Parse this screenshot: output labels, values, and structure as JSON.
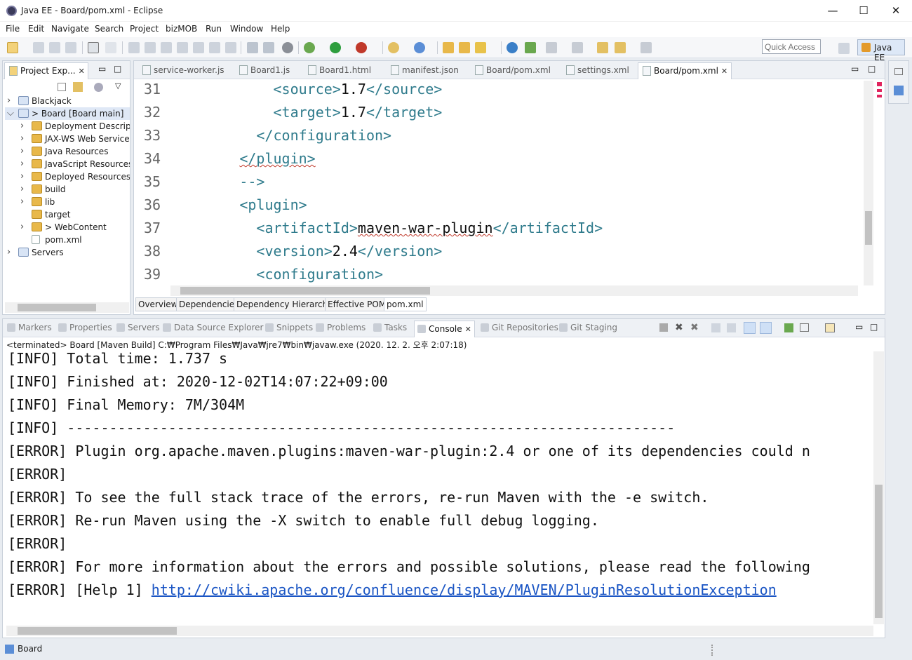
{
  "window": {
    "title": "Java EE - Board/pom.xml - Eclipse",
    "minimize": "—",
    "maximize": "☐",
    "close": "✕"
  },
  "menu": [
    "File",
    "Edit",
    "Navigate",
    "Search",
    "Project",
    "bizMOB",
    "Run",
    "Window",
    "Help"
  ],
  "toolbar": {
    "quick_access_placeholder": "Quick Access",
    "perspective_label": "Java EE"
  },
  "project_explorer": {
    "tab_label": "Project Exp...",
    "items": [
      {
        "label": "Blackjack",
        "level": 0,
        "expanded": false
      },
      {
        "label": "> Board  [Board main]",
        "level": 0,
        "expanded": true,
        "selected": true
      },
      {
        "label": "Deployment Descript",
        "level": 1,
        "expanded": false
      },
      {
        "label": "JAX-WS Web Services",
        "level": 1,
        "expanded": false
      },
      {
        "label": "Java Resources",
        "level": 1,
        "expanded": false
      },
      {
        "label": "JavaScript Resources",
        "level": 1,
        "expanded": false
      },
      {
        "label": "Deployed Resources",
        "level": 1,
        "expanded": false
      },
      {
        "label": "build",
        "level": 1,
        "expanded": false
      },
      {
        "label": "lib",
        "level": 1,
        "expanded": false
      },
      {
        "label": "target",
        "level": 1,
        "expanded": null
      },
      {
        "label": "> WebContent",
        "level": 1,
        "expanded": false
      },
      {
        "label": "pom.xml",
        "level": 1,
        "expanded": null
      },
      {
        "label": "Servers",
        "level": 0,
        "expanded": false
      }
    ]
  },
  "editor": {
    "tabs": [
      {
        "label": "service-worker.js",
        "active": false
      },
      {
        "label": "Board1.js",
        "active": false
      },
      {
        "label": "Board1.html",
        "active": false
      },
      {
        "label": "manifest.json",
        "active": false
      },
      {
        "label": "Board/pom.xml",
        "active": false
      },
      {
        "label": "settings.xml",
        "active": false
      },
      {
        "label": "Board/pom.xml",
        "active": true
      }
    ],
    "lines": [
      {
        "num": "31",
        "indent": "      ",
        "parts": [
          [
            "tag",
            "<source>"
          ],
          [
            "txt",
            "1.7"
          ],
          [
            "tag",
            "</source>"
          ]
        ]
      },
      {
        "num": "32",
        "indent": "      ",
        "parts": [
          [
            "tag",
            "<target>"
          ],
          [
            "txt",
            "1.7"
          ],
          [
            "tag",
            "</target>"
          ]
        ]
      },
      {
        "num": "33",
        "indent": "    ",
        "parts": [
          [
            "tag",
            "</configuration>"
          ]
        ]
      },
      {
        "num": "34",
        "indent": "  ",
        "parts": [
          [
            "tagw",
            "</plugin>"
          ]
        ]
      },
      {
        "num": "35",
        "indent": "  ",
        "parts": [
          [
            "tag",
            "-->"
          ]
        ]
      },
      {
        "num": "36",
        "indent": "  ",
        "parts": [
          [
            "tag",
            "<plugin>"
          ]
        ]
      },
      {
        "num": "37",
        "indent": "    ",
        "parts": [
          [
            "tag",
            "<artifactId>"
          ],
          [
            "txtw",
            "maven-war-plugin"
          ],
          [
            "tag",
            "</artifactId>"
          ]
        ]
      },
      {
        "num": "38",
        "indent": "    ",
        "parts": [
          [
            "tag",
            "<version>"
          ],
          [
            "txt",
            "2.4"
          ],
          [
            "tag",
            "</version>"
          ]
        ]
      },
      {
        "num": "39",
        "indent": "    ",
        "parts": [
          [
            "tag",
            "<configuration>"
          ]
        ]
      }
    ],
    "bottom_tabs": [
      "Overview",
      "Dependencies",
      "Dependency Hierarchy",
      "Effective POM",
      "pom.xml"
    ]
  },
  "console": {
    "view_tabs": [
      "Markers",
      "Properties",
      "Servers",
      "Data Source Explorer",
      "Snippets",
      "Problems",
      "Tasks",
      "Console",
      "Git Repositories",
      "Git Staging"
    ],
    "header": "<terminated> Board [Maven Build] C:₩Program Files₩Java₩jre7₩bin₩javaw.exe (2020. 12. 2. 오후 2:07:18)",
    "lines": [
      "[INFO] Total time: 1.737 s",
      "[INFO] Finished at: 2020-12-02T14:07:22+09:00",
      "[INFO] Final Memory: 7M/304M",
      "[INFO] ------------------------------------------------------------------------",
      "[ERROR] Plugin org.apache.maven.plugins:maven-war-plugin:2.4 or one of its dependencies could n",
      "[ERROR]",
      "[ERROR] To see the full stack trace of the errors, re-run Maven with the -e switch.",
      "[ERROR] Re-run Maven using the -X switch to enable full debug logging.",
      "[ERROR]",
      "[ERROR] For more information about the errors and possible solutions, please read the following"
    ],
    "help_prefix": "[ERROR] [Help 1] ",
    "help_link": "http://cwiki.apache.org/confluence/display/MAVEN/PluginResolutionException"
  },
  "status_bar": {
    "text": "Board"
  }
}
